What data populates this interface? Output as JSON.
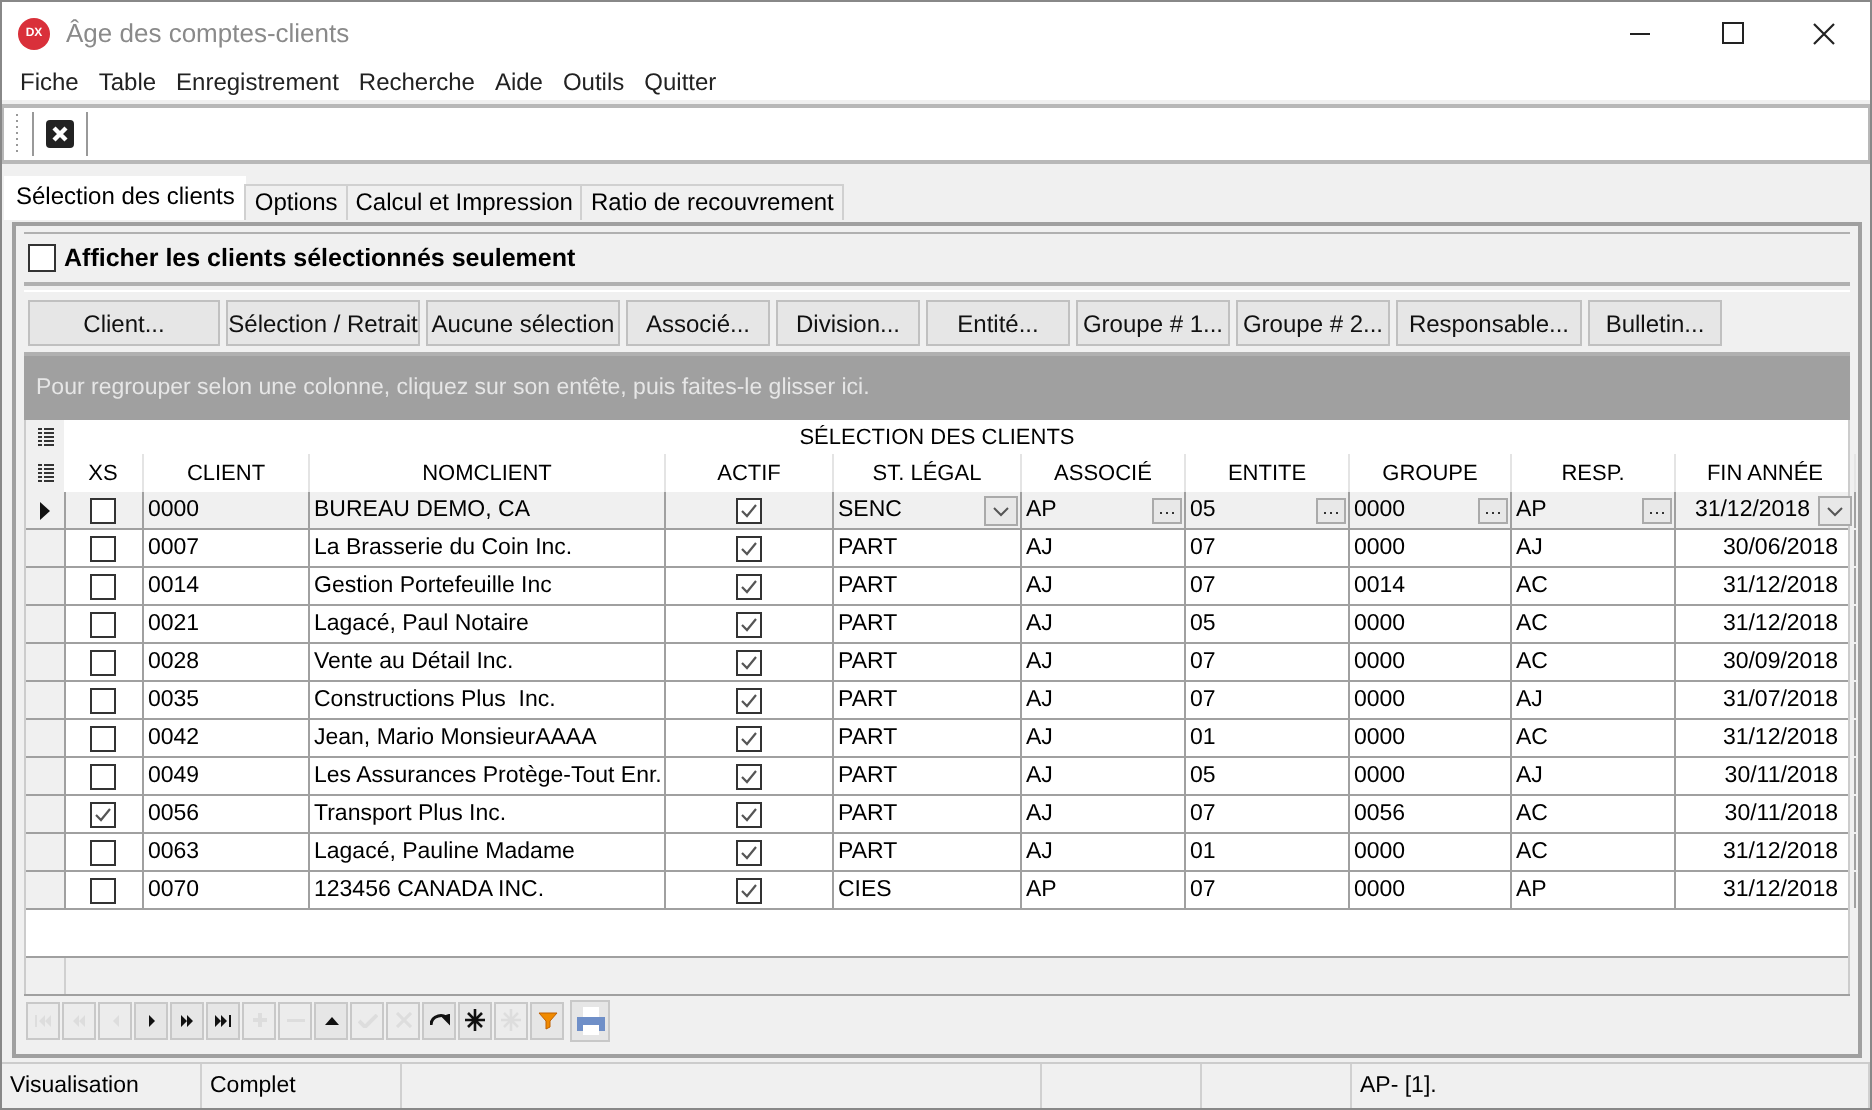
{
  "window": {
    "title": "Âge des comptes-clients",
    "logo_text": "DX"
  },
  "menu": [
    "Fiche",
    "Table",
    "Enregistrement",
    "Recherche",
    "Aide",
    "Outils",
    "Quitter"
  ],
  "tabs": [
    {
      "label": "Sélection des clients",
      "selected": true
    },
    {
      "label": "Options",
      "selected": false
    },
    {
      "label": "Calcul et Impression",
      "selected": false
    },
    {
      "label": "Ratio de recouvrement",
      "selected": false
    }
  ],
  "show_selected_only": {
    "label": "Afficher les clients sélectionnés seulement",
    "checked": false
  },
  "buttons": [
    "Client...",
    "Sélection / Retrait",
    "Aucune sélection",
    "Associé...",
    "Division...",
    "Entité...",
    "Groupe # 1...",
    "Groupe # 2...",
    "Responsable...",
    "Bulletin..."
  ],
  "group_panel": {
    "hint": "Pour regrouper selon une colonne, cliquez sur son entête, puis faites-le glisser ici."
  },
  "table": {
    "title": "SÉLECTION DES CLIENTS",
    "columns": [
      {
        "label": "XS",
        "kind": "check"
      },
      {
        "label": "CLIENT",
        "kind": "text"
      },
      {
        "label": "NOMCLIENT",
        "kind": "text"
      },
      {
        "label": "ACTIF",
        "kind": "check"
      },
      {
        "label": "ST. LÉGAL",
        "kind": "combo"
      },
      {
        "label": "ASSOCIÉ",
        "kind": "lookup"
      },
      {
        "label": "ENTITE",
        "kind": "lookup"
      },
      {
        "label": "GROUPE",
        "kind": "lookup"
      },
      {
        "label": "RESP.",
        "kind": "lookup"
      },
      {
        "label": "FIN ANNÉE",
        "kind": "date"
      }
    ],
    "rows": [
      {
        "selected": true,
        "cells": [
          false,
          "0000",
          "BUREAU DEMO, CA",
          true,
          "SENC",
          "AP",
          "05",
          "0000",
          "AP",
          "31/12/2018"
        ]
      },
      {
        "selected": false,
        "cells": [
          false,
          "0007",
          "La Brasserie du Coin Inc.",
          true,
          "PART",
          "AJ",
          "07",
          "0000",
          "AJ",
          "30/06/2018"
        ]
      },
      {
        "selected": false,
        "cells": [
          false,
          "0014",
          "Gestion Portefeuille Inc",
          true,
          "PART",
          "AJ",
          "07",
          "0014",
          "AC",
          "31/12/2018"
        ]
      },
      {
        "selected": false,
        "cells": [
          false,
          "0021",
          "Lagacé, Paul Notaire",
          true,
          "PART",
          "AJ",
          "05",
          "0000",
          "AC",
          "31/12/2018"
        ]
      },
      {
        "selected": false,
        "cells": [
          false,
          "0028",
          "Vente au Détail Inc.",
          true,
          "PART",
          "AJ",
          "07",
          "0000",
          "AC",
          "30/09/2018"
        ]
      },
      {
        "selected": false,
        "cells": [
          false,
          "0035",
          "Constructions Plus  Inc.",
          true,
          "PART",
          "AJ",
          "07",
          "0000",
          "AJ",
          "31/07/2018"
        ]
      },
      {
        "selected": false,
        "cells": [
          false,
          "0042",
          "Jean, Mario MonsieurAAAA",
          true,
          "PART",
          "AJ",
          "01",
          "0000",
          "AC",
          "31/12/2018"
        ]
      },
      {
        "selected": false,
        "cells": [
          false,
          "0049",
          "Les Assurances Protège-Tout Enr.",
          true,
          "PART",
          "AJ",
          "05",
          "0000",
          "AJ",
          "30/11/2018"
        ]
      },
      {
        "selected": false,
        "cells": [
          true,
          "0056",
          "Transport Plus Inc.",
          true,
          "PART",
          "AJ",
          "07",
          "0056",
          "AC",
          "30/11/2018"
        ]
      },
      {
        "selected": false,
        "cells": [
          false,
          "0063",
          "Lagacé, Pauline Madame",
          true,
          "PART",
          "AJ",
          "01",
          "0000",
          "AC",
          "31/12/2018"
        ]
      },
      {
        "selected": false,
        "cells": [
          false,
          "0070",
          "123456 CANADA INC.",
          true,
          "CIES",
          "AP",
          "07",
          "0000",
          "AP",
          "31/12/2018"
        ]
      }
    ]
  },
  "navigator": [
    {
      "kind": "first",
      "disabled": true
    },
    {
      "kind": "prior-page",
      "disabled": true
    },
    {
      "kind": "prior",
      "disabled": true
    },
    {
      "kind": "next",
      "disabled": false
    },
    {
      "kind": "next-page",
      "disabled": false
    },
    {
      "kind": "last",
      "disabled": false
    },
    {
      "kind": "insert",
      "disabled": true
    },
    {
      "kind": "delete",
      "disabled": true
    },
    {
      "kind": "edit",
      "disabled": false
    },
    {
      "kind": "post",
      "disabled": true
    },
    {
      "kind": "cancel",
      "disabled": true
    },
    {
      "kind": "refresh",
      "disabled": false
    },
    {
      "kind": "bookmark",
      "disabled": false
    },
    {
      "kind": "goto-bookmark",
      "disabled": true
    },
    {
      "kind": "filter",
      "disabled": false
    },
    {
      "kind": "print",
      "disabled": false
    }
  ],
  "status_bar": {
    "mode": "Visualisation",
    "state": "Complet",
    "record": "AP- [1]."
  }
}
